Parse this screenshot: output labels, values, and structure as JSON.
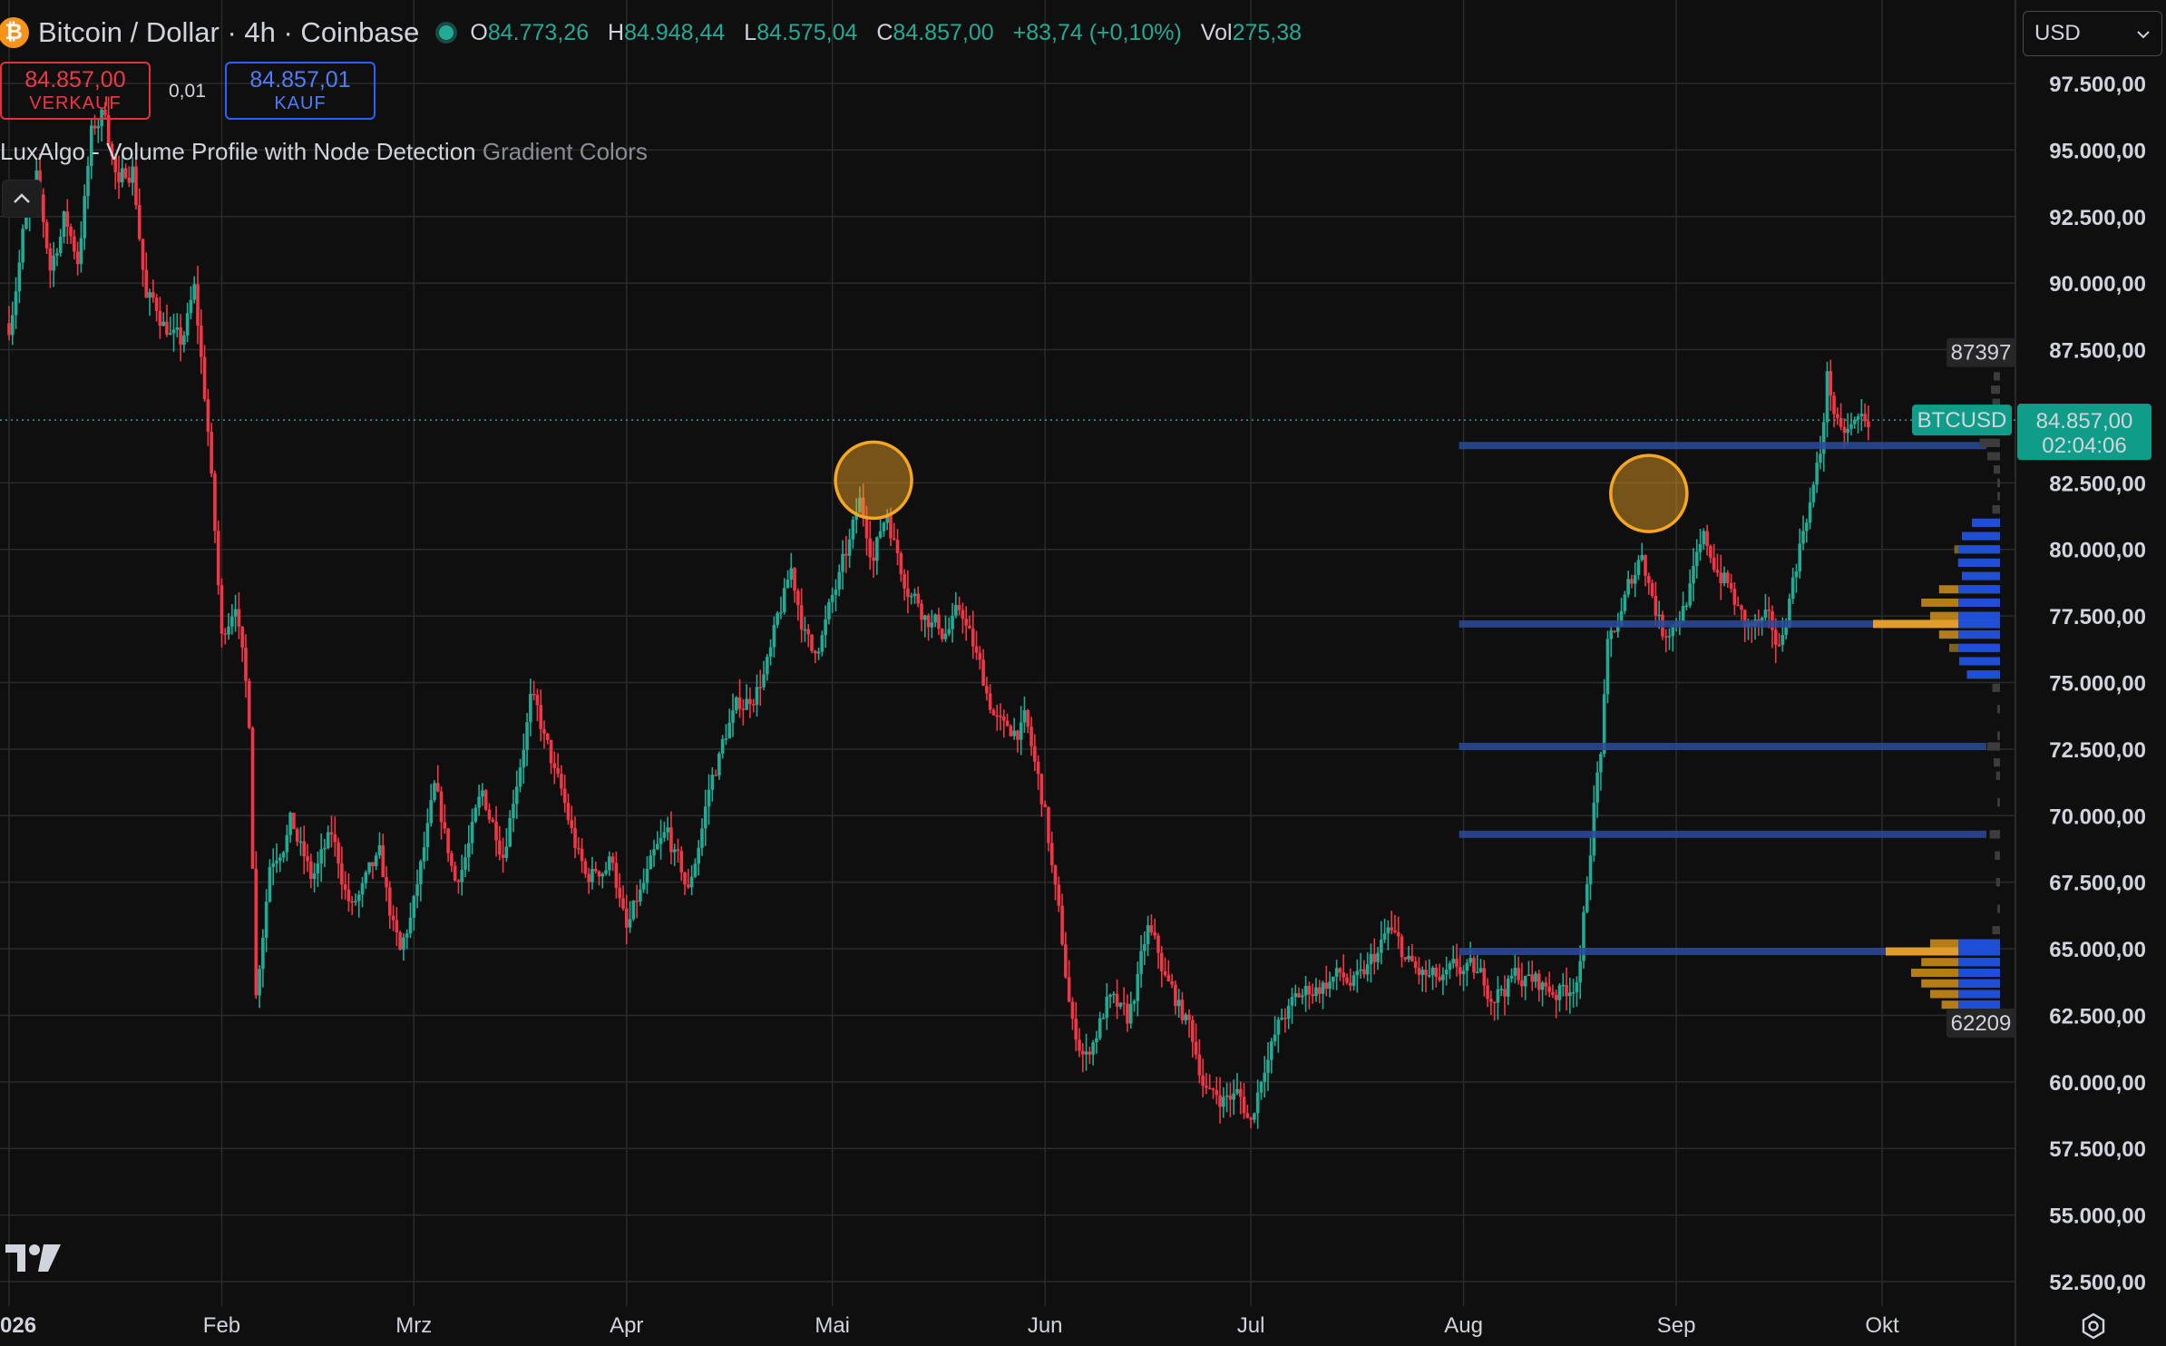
{
  "header": {
    "symbol_icon": "₿",
    "title": "Bitcoin / Dollar · 4h · Coinbase",
    "ohlc": [
      {
        "key": "O",
        "value": "84.773,26"
      },
      {
        "key": "H",
        "value": "84.948,44"
      },
      {
        "key": "L",
        "value": "84.575,04"
      },
      {
        "key": "C",
        "value": "84.857,00"
      }
    ],
    "change": "+83,74 (+0,10%)",
    "vol_label": "Vol",
    "vol_value": "275,38"
  },
  "trade": {
    "sell_price": "84.857,00",
    "sell_label": "VERKAUF",
    "spread": "0,01",
    "buy_price": "84.857,01",
    "buy_label": "KAUF"
  },
  "indicator": {
    "name": "LuxAlgo - Volume Profile with Node Detection",
    "option": "Gradient Colors",
    "collapse_icon": "^"
  },
  "currency": {
    "value": "USD",
    "icon": "chevron-down-icon"
  },
  "colors": {
    "up": "#22ab94",
    "down": "#f23645",
    "accent": "#2962ff",
    "highlight": "#f5a623"
  },
  "chart_data": {
    "type": "candlestick",
    "symbol": "BTCUSD",
    "timeframe": "4h",
    "x_tick_labels": [
      {
        "label": "026",
        "bold": true,
        "date": "2026-01-01"
      },
      {
        "label": "Feb",
        "date": "2026-02-01"
      },
      {
        "label": "Mrz",
        "date": "2026-03-01"
      },
      {
        "label": "Apr",
        "date": "2026-04-01"
      },
      {
        "label": "Mai",
        "date": "2026-05-01"
      },
      {
        "label": "Jun",
        "date": "2026-06-01"
      },
      {
        "label": "Jul",
        "date": "2026-07-01"
      },
      {
        "label": "Aug",
        "date": "2026-08-01"
      },
      {
        "label": "Sep",
        "date": "2026-09-01"
      },
      {
        "label": "Okt",
        "date": "2026-10-01"
      }
    ],
    "y_ticks": [
      {
        "value": 97500,
        "label": "97.500,00"
      },
      {
        "value": 95000,
        "label": "95.000,00"
      },
      {
        "value": 92500,
        "label": "92.500,00"
      },
      {
        "value": 90000,
        "label": "90.000,00"
      },
      {
        "value": 87500,
        "label": "87.500,00"
      },
      {
        "value": 82500,
        "label": "82.500,00"
      },
      {
        "value": 80000,
        "label": "80.000,00"
      },
      {
        "value": 77500,
        "label": "77.500,00"
      },
      {
        "value": 75000,
        "label": "75.000,00"
      },
      {
        "value": 72500,
        "label": "72.500,00"
      },
      {
        "value": 70000,
        "label": "70.000,00"
      },
      {
        "value": 67500,
        "label": "67.500,00"
      },
      {
        "value": 65000,
        "label": "65.000,00"
      },
      {
        "value": 62500,
        "label": "62.500,00"
      },
      {
        "value": 60000,
        "label": "60.000,00"
      },
      {
        "value": 57500,
        "label": "57.500,00"
      },
      {
        "value": 55000,
        "label": "55.000,00"
      },
      {
        "value": 52500,
        "label": "52.500,00"
      }
    ],
    "ylim": [
      51500,
      99000
    ],
    "xlim": [
      "2026-01-01",
      "2026-10-20"
    ],
    "grid": true,
    "price_path": [
      [
        "2026-01-01",
        88500
      ],
      [
        "2026-01-03",
        92000
      ],
      [
        "2026-01-05",
        93500
      ],
      [
        "2026-01-07",
        90500
      ],
      [
        "2026-01-09",
        92500
      ],
      [
        "2026-01-11",
        91000
      ],
      [
        "2026-01-13",
        95500
      ],
      [
        "2026-01-15",
        96500
      ],
      [
        "2026-01-17",
        93500
      ],
      [
        "2026-01-19",
        94500
      ],
      [
        "2026-01-21",
        89500
      ],
      [
        "2026-01-24",
        88500
      ],
      [
        "2026-01-26",
        87500
      ],
      [
        "2026-01-28",
        89500
      ],
      [
        "2026-01-30",
        84500
      ],
      [
        "2026-02-01",
        76500
      ],
      [
        "2026-02-03",
        78500
      ],
      [
        "2026-02-05",
        73500
      ],
      [
        "2026-02-06",
        63500
      ],
      [
        "2026-02-08",
        68500
      ],
      [
        "2026-02-11",
        70000
      ],
      [
        "2026-02-14",
        67500
      ],
      [
        "2026-02-17",
        69000
      ],
      [
        "2026-02-20",
        66500
      ],
      [
        "2026-02-24",
        68000
      ],
      [
        "2026-02-27",
        64500
      ],
      [
        "2026-03-01",
        66500
      ],
      [
        "2026-03-04",
        70500
      ],
      [
        "2026-03-07",
        67500
      ],
      [
        "2026-03-11",
        70500
      ],
      [
        "2026-03-14",
        69000
      ],
      [
        "2026-03-18",
        74500
      ],
      [
        "2026-03-22",
        71000
      ],
      [
        "2026-03-26",
        67500
      ],
      [
        "2026-03-30",
        68500
      ],
      [
        "2026-04-01",
        65500
      ],
      [
        "2026-04-04",
        67500
      ],
      [
        "2026-04-07",
        69000
      ],
      [
        "2026-04-10",
        67000
      ],
      [
        "2026-04-13",
        71000
      ],
      [
        "2026-04-16",
        73500
      ],
      [
        "2026-04-19",
        74500
      ],
      [
        "2026-04-22",
        76000
      ],
      [
        "2026-04-25",
        79000
      ],
      [
        "2026-04-28",
        76000
      ],
      [
        "2026-05-01",
        78000
      ],
      [
        "2026-05-03",
        79500
      ],
      [
        "2026-05-05",
        81500
      ],
      [
        "2026-05-07",
        80000
      ],
      [
        "2026-05-09",
        81500
      ],
      [
        "2026-05-11",
        79500
      ],
      [
        "2026-05-14",
        78000
      ],
      [
        "2026-05-17",
        77000
      ],
      [
        "2026-05-20",
        77500
      ],
      [
        "2026-05-23",
        75000
      ],
      [
        "2026-05-26",
        73000
      ],
      [
        "2026-05-29",
        73500
      ],
      [
        "2026-06-01",
        70000
      ],
      [
        "2026-06-03",
        66000
      ],
      [
        "2026-06-05",
        62000
      ],
      [
        "2026-06-07",
        61000
      ],
      [
        "2026-06-10",
        63000
      ],
      [
        "2026-06-13",
        62000
      ],
      [
        "2026-06-16",
        65500
      ],
      [
        "2026-06-19",
        63500
      ],
      [
        "2026-06-22",
        62000
      ],
      [
        "2026-06-25",
        59500
      ],
      [
        "2026-06-29",
        59500
      ],
      [
        "2026-07-01",
        58500
      ],
      [
        "2026-07-03",
        61000
      ],
      [
        "2026-07-06",
        62500
      ],
      [
        "2026-07-10",
        63500
      ],
      [
        "2026-07-13",
        64000
      ],
      [
        "2026-07-17",
        63500
      ],
      [
        "2026-07-21",
        65500
      ],
      [
        "2026-07-25",
        64000
      ],
      [
        "2026-07-29",
        63500
      ],
      [
        "2026-08-01",
        64000
      ],
      [
        "2026-08-05",
        63500
      ],
      [
        "2026-08-09",
        64000
      ],
      [
        "2026-08-13",
        63500
      ],
      [
        "2026-08-16",
        63500
      ],
      [
        "2026-08-18",
        64500
      ],
      [
        "2026-08-19",
        67500
      ],
      [
        "2026-08-20",
        70500
      ],
      [
        "2026-08-21",
        72500
      ],
      [
        "2026-08-22",
        76000
      ],
      [
        "2026-08-24",
        77500
      ],
      [
        "2026-08-27",
        80000
      ],
      [
        "2026-08-30",
        77000
      ],
      [
        "2026-09-02",
        78000
      ],
      [
        "2026-09-05",
        80000
      ],
      [
        "2026-09-08",
        79000
      ],
      [
        "2026-09-11",
        77000
      ],
      [
        "2026-09-14",
        77000
      ],
      [
        "2026-09-16",
        76000
      ],
      [
        "2026-09-18",
        79000
      ],
      [
        "2026-09-20",
        81500
      ],
      [
        "2026-09-22",
        83500
      ],
      [
        "2026-09-23",
        86500
      ],
      [
        "2026-09-25",
        84000
      ],
      [
        "2026-09-27",
        84500
      ],
      [
        "2026-09-29",
        84857
      ]
    ],
    "last_price": {
      "value": 84857,
      "symbol_tag": "BTCUSD",
      "label": "84.857,00",
      "countdown": "02:04:06"
    },
    "profile_high": {
      "value": 87397,
      "label": "87397"
    },
    "profile_low": {
      "value": 62209,
      "label": "62209"
    },
    "node_levels": [
      83900,
      77200,
      72600,
      69300,
      64900
    ],
    "highlight_circles": [
      {
        "date": "2026-05-07",
        "value": 82600
      },
      {
        "date": "2026-08-28",
        "value": 82100
      }
    ],
    "volume_profile": {
      "range_start": "2026-08-01",
      "bins": [
        {
          "price": 86500,
          "vol": 0.05
        },
        {
          "price": 86000,
          "vol": 0.07
        },
        {
          "price": 85500,
          "vol": 0.06
        },
        {
          "price": 85000,
          "vol": 0.08
        },
        {
          "price": 84500,
          "vol": 0.12
        },
        {
          "price": 84000,
          "vol": 0.16
        },
        {
          "price": 83500,
          "vol": 0.1
        },
        {
          "price": 83000,
          "vol": 0.05
        },
        {
          "price": 82500,
          "vol": 0.02
        },
        {
          "price": 82000,
          "vol": 0.02
        },
        {
          "price": 81500,
          "vol": 0.06
        },
        {
          "price": 81000,
          "vol": 0.22
        },
        {
          "price": 80500,
          "vol": 0.3
        },
        {
          "price": 80000,
          "vol": 0.36
        },
        {
          "price": 79500,
          "vol": 0.33
        },
        {
          "price": 79000,
          "vol": 0.3
        },
        {
          "price": 78500,
          "vol": 0.48
        },
        {
          "price": 78000,
          "vol": 0.62
        },
        {
          "price": 77500,
          "vol": 0.55
        },
        {
          "price": 77200,
          "vol": 1.0
        },
        {
          "price": 76800,
          "vol": 0.48
        },
        {
          "price": 76300,
          "vol": 0.4
        },
        {
          "price": 75800,
          "vol": 0.32
        },
        {
          "price": 75300,
          "vol": 0.26
        },
        {
          "price": 74800,
          "vol": 0.06
        },
        {
          "price": 74000,
          "vol": 0.02
        },
        {
          "price": 73000,
          "vol": 0.02
        },
        {
          "price": 72600,
          "vol": 0.1
        },
        {
          "price": 72000,
          "vol": 0.05
        },
        {
          "price": 71500,
          "vol": 0.03
        },
        {
          "price": 70500,
          "vol": 0.02
        },
        {
          "price": 69300,
          "vol": 0.08
        },
        {
          "price": 68500,
          "vol": 0.04
        },
        {
          "price": 67500,
          "vol": 0.03
        },
        {
          "price": 66500,
          "vol": 0.02
        },
        {
          "price": 65700,
          "vol": 0.06
        },
        {
          "price": 65200,
          "vol": 0.55
        },
        {
          "price": 64900,
          "vol": 0.9
        },
        {
          "price": 64500,
          "vol": 0.62
        },
        {
          "price": 64100,
          "vol": 0.7
        },
        {
          "price": 63700,
          "vol": 0.62
        },
        {
          "price": 63300,
          "vol": 0.55
        },
        {
          "price": 62900,
          "vol": 0.46
        },
        {
          "price": 62500,
          "vol": 0.34
        },
        {
          "price": 62209,
          "vol": 0.15
        }
      ]
    }
  }
}
